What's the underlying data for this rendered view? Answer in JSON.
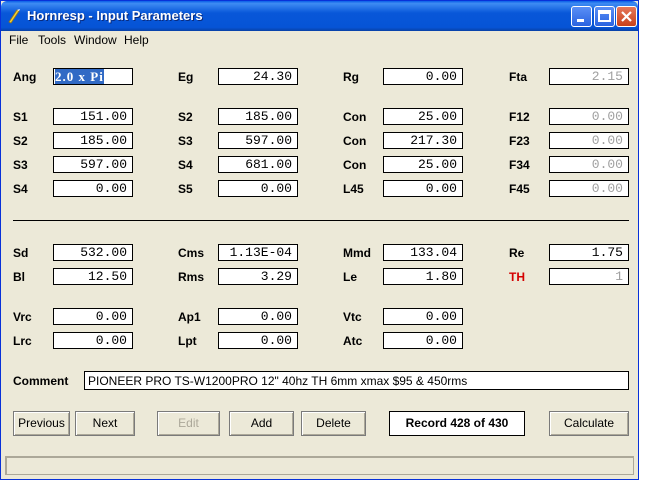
{
  "window": {
    "title": "Hornresp - Input Parameters"
  },
  "menu": {
    "file": "File",
    "tools": "Tools",
    "window": "Window",
    "help": "Help"
  },
  "params": {
    "ang_label": "Ang",
    "ang_value": "2.0 x Pi",
    "eg_label": "Eg",
    "eg_value": "24.30",
    "rg_label": "Rg",
    "rg_value": "0.00",
    "fta_label": "Fta",
    "fta_value": "2.15",
    "s1a_label": "S1",
    "s1a_value": "151.00",
    "s2a_label": "S2",
    "s2a_value": "185.00",
    "con1_label": "Con",
    "con1_value": "25.00",
    "f12_label": "F12",
    "f12_value": "0.00",
    "s2b_label": "S2",
    "s2b_value": "185.00",
    "s3a_label": "S3",
    "s3a_value": "597.00",
    "con2_label": "Con",
    "con2_value": "217.30",
    "f23_label": "F23",
    "f23_value": "0.00",
    "s3b_label": "S3",
    "s3b_value": "597.00",
    "s4a_label": "S4",
    "s4a_value": "681.00",
    "con3_label": "Con",
    "con3_value": "25.00",
    "f34_label": "F34",
    "f34_value": "0.00",
    "s4b_label": "S4",
    "s4b_value": "0.00",
    "s5_label": "S5",
    "s5_value": "0.00",
    "l45_label": "L45",
    "l45_value": "0.00",
    "f45_label": "F45",
    "f45_value": "0.00",
    "sd_label": "Sd",
    "sd_value": "532.00",
    "cms_label": "Cms",
    "cms_value": "1.13E-04",
    "mmd_label": "Mmd",
    "mmd_value": "133.04",
    "re_label": "Re",
    "re_value": "1.75",
    "bl_label": "Bl",
    "bl_value": "12.50",
    "rms_label": "Rms",
    "rms_value": "3.29",
    "le_label": "Le",
    "le_value": "1.80",
    "th_label": "TH",
    "th_value": "1",
    "vrc_label": "Vrc",
    "vrc_value": "0.00",
    "ap1_label": "Ap1",
    "ap1_value": "0.00",
    "vtc_label": "Vtc",
    "vtc_value": "0.00",
    "lrc_label": "Lrc",
    "lrc_value": "0.00",
    "lpt_label": "Lpt",
    "lpt_value": "0.00",
    "atc_label": "Atc",
    "atc_value": "0.00"
  },
  "comment": {
    "label": "Comment",
    "value": "PIONEER PRO TS-W1200PRO 12\" 40hz TH 6mm xmax $95 & 450rms"
  },
  "buttons": {
    "previous": "Previous",
    "next": "Next",
    "edit": "Edit",
    "add": "Add",
    "delete": "Delete",
    "calculate": "Calculate"
  },
  "record": "Record 428 of 430",
  "colors": {
    "titlebar": "#0654d6",
    "highlight": "#316ac5",
    "th_label": "#d40000"
  }
}
